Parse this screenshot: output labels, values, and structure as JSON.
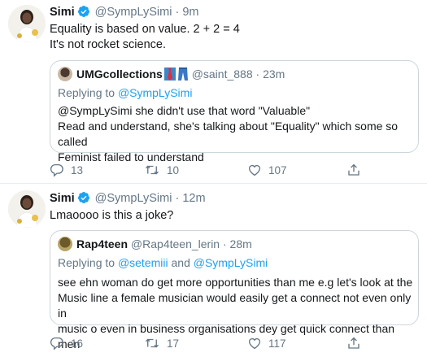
{
  "tweets": [
    {
      "name": "Simi",
      "handle": "@SympLySimi",
      "separator": "·",
      "time": "9m",
      "lines": [
        "Equality is based on value. 2 + 2 = 4",
        "It's not rocket science."
      ],
      "quote": {
        "name": "UMGcollections",
        "handle": "@saint_888",
        "separator": "·",
        "time": "23m",
        "replying_label": "Replying to",
        "replying_to": "@SympLySimi",
        "lines": [
          "@SympLySimi  she didn't use that word \"Valuable\"",
          "Read and understand, she's talking about \"Equality\" which some so called",
          "Feminist failed to understand"
        ]
      },
      "stats": {
        "replies": "13",
        "retweets": "10",
        "likes": "107"
      }
    },
    {
      "name": "Simi",
      "handle": "@SympLySimi",
      "separator": "·",
      "time": "12m",
      "lines": [
        "Lmaoooo is this a joke?"
      ],
      "quote": {
        "name": "Rap4teen",
        "handle": "@Rap4teen_lerin",
        "separator": "·",
        "time": "28m",
        "replying_label": "Replying to",
        "replying_to": "@setemiii",
        "replying_and": "and",
        "replying_to_2": "@SympLySimi",
        "lines": [
          "see ehn woman do get more opportunities than me e.g let's look at the",
          "Music line a female musician would easily get a connect not even only in",
          "music o even in business organisations dey get quick connect than men"
        ]
      },
      "stats": {
        "replies": "16",
        "retweets": "17",
        "likes": "117"
      }
    }
  ],
  "colors": {
    "accent": "#1da1f2",
    "muted": "#657786",
    "text": "#14171a",
    "border": "#ccd6dd"
  },
  "icons": [
    "verified-icon",
    "reply-icon",
    "retweet-icon",
    "like-icon",
    "share-icon"
  ]
}
